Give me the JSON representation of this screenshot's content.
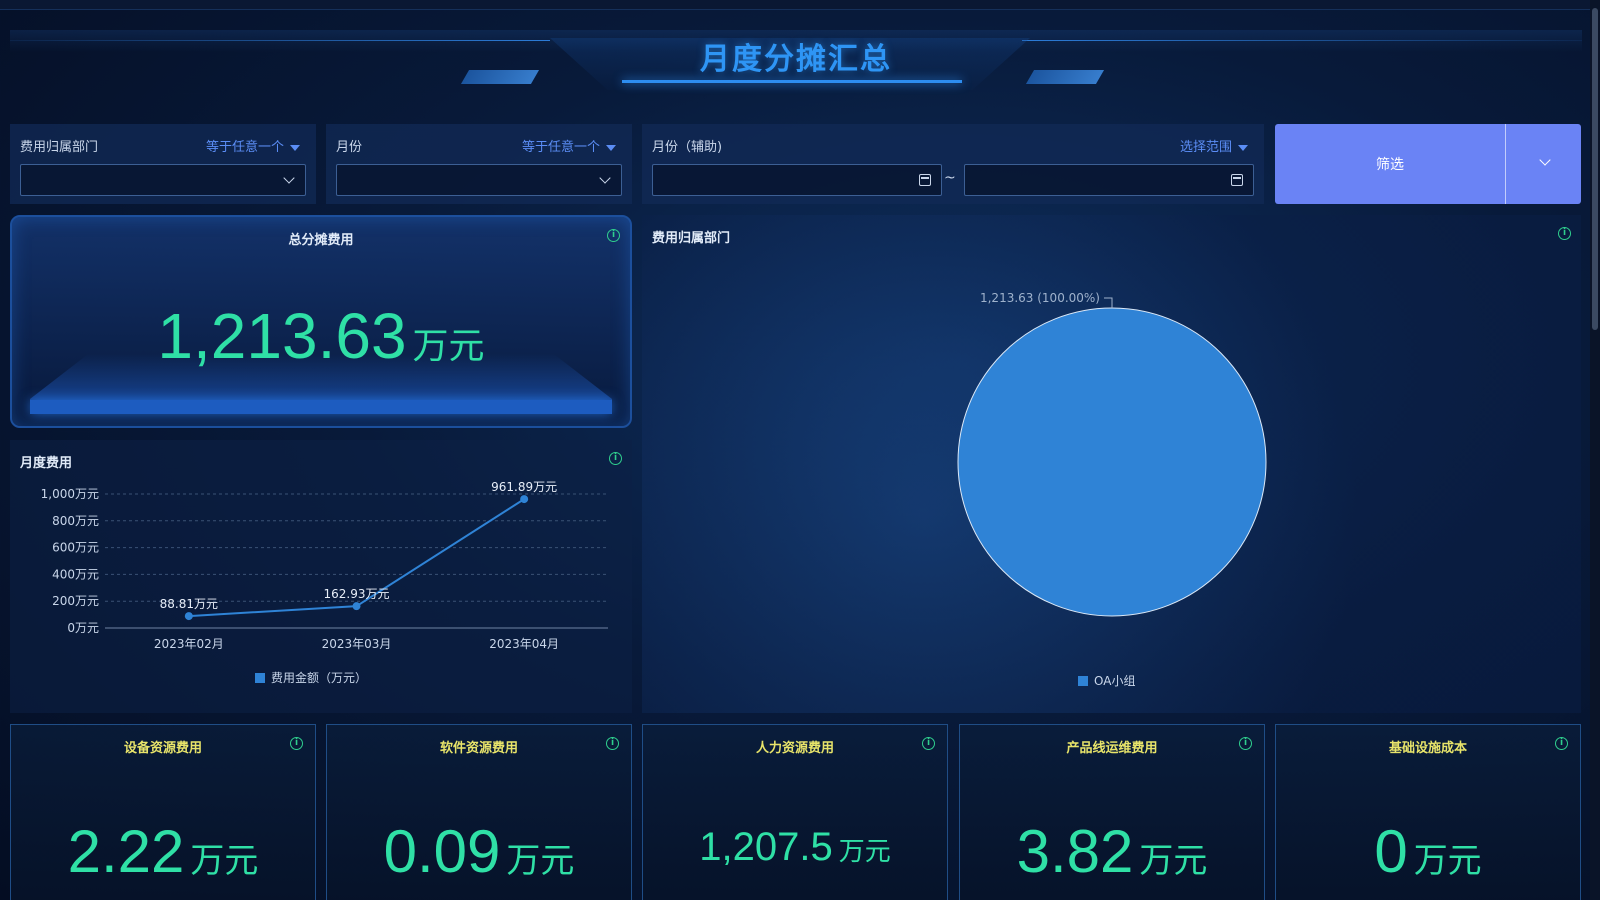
{
  "header": {
    "title": "月度分摊汇总"
  },
  "filters": {
    "department": {
      "label": "费用归属部门",
      "operator": "等于任意一个"
    },
    "month": {
      "label": "月份",
      "operator": "等于任意一个"
    },
    "month_aux": {
      "label": "月份（辅助)",
      "operator": "选择范围",
      "separator": "~"
    },
    "submit_label": "筛选"
  },
  "total": {
    "title": "总分摊费用",
    "value": "1,213.63",
    "unit": "万元"
  },
  "line_chart": {
    "title": "月度费用"
  },
  "pie_chart": {
    "title": "费用归属部门"
  },
  "cards": [
    {
      "title": "设备资源费用",
      "value": "2.22",
      "unit": "万元"
    },
    {
      "title": "软件资源费用",
      "value": "0.09",
      "unit": "万元"
    },
    {
      "title": "人力资源费用",
      "value": "1,207.5",
      "unit": "万元"
    },
    {
      "title": "产品线运维费用",
      "value": "3.82",
      "unit": "万元"
    },
    {
      "title": "基础设施成本",
      "value": "0",
      "unit": "万元"
    }
  ],
  "colors": {
    "accent": "#2e95f5",
    "value": "#2fe0a6",
    "card_title": "#e8e46a",
    "button": "#6a83f5",
    "series": "#2f83d6",
    "info": "#2fcf8e"
  },
  "chart_data": [
    {
      "type": "line",
      "title": "月度费用",
      "categories": [
        "2023年02月",
        "2023年03月",
        "2023年04月"
      ],
      "series": [
        {
          "name": "费用金额（万元）",
          "values": [
            88.81,
            162.93,
            961.89
          ]
        }
      ],
      "data_labels": [
        "88.81万元",
        "162.93万元",
        "961.89万元"
      ],
      "yticks": [
        "0万元",
        "200万元",
        "400万元",
        "600万元",
        "800万元",
        "1,000万元"
      ],
      "ylim": [
        0,
        1000
      ],
      "grid": true,
      "legend": "bottom"
    },
    {
      "type": "pie",
      "title": "费用归属部门",
      "slices": [
        {
          "name": "OA小组",
          "value": 1213.63,
          "percent": 100.0
        }
      ],
      "data_label": "1,213.63 (100.00%)",
      "legend": "bottom"
    }
  ]
}
